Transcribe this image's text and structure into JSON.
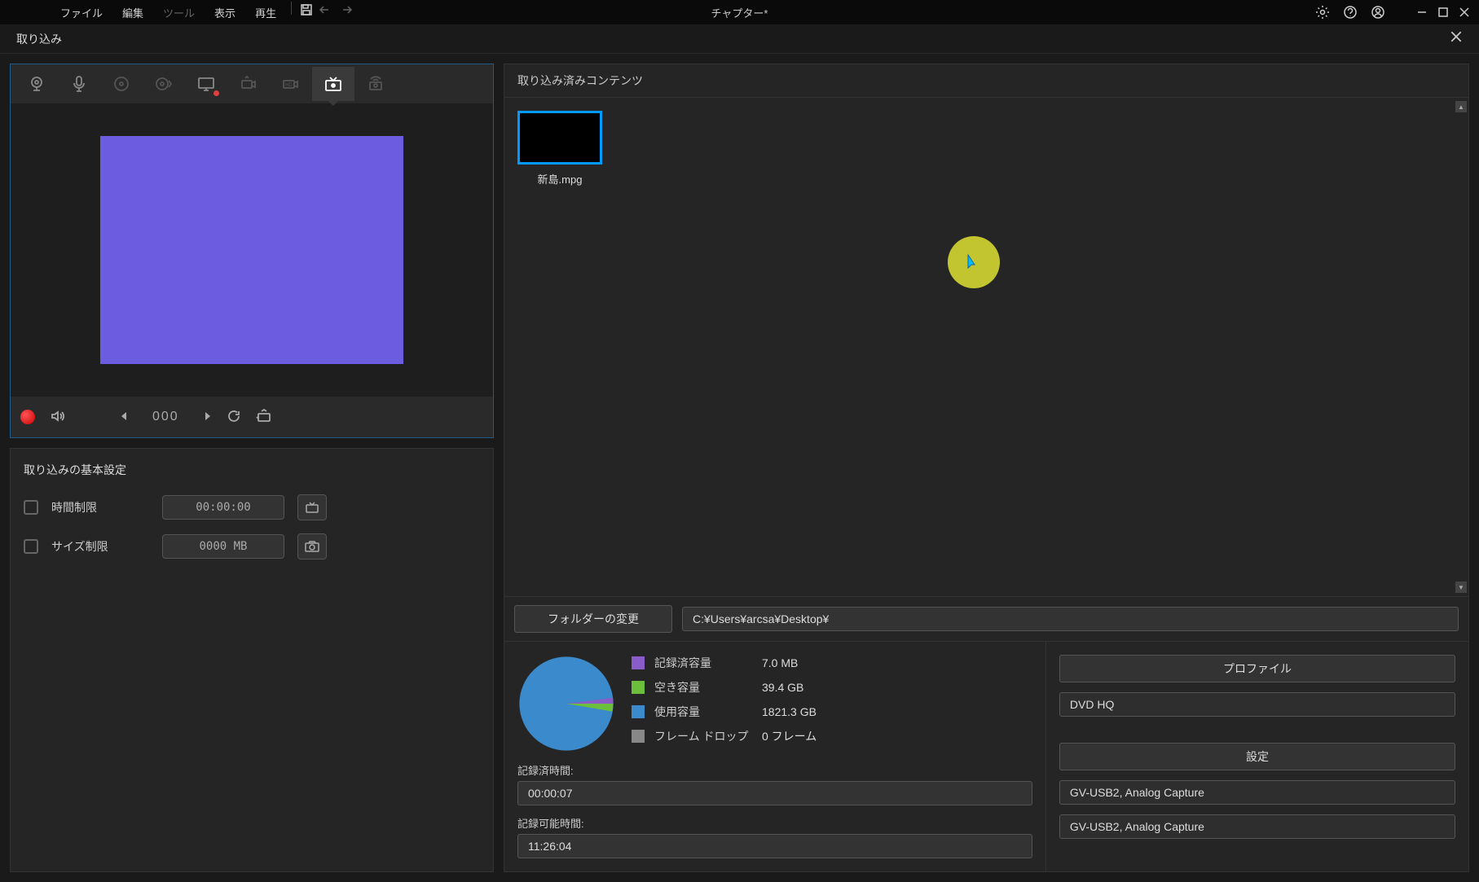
{
  "menu": {
    "file": "ファイル",
    "edit": "編集",
    "tool": "ツール",
    "view": "表示",
    "play": "再生"
  },
  "title": "チャプター*",
  "subHeader": "取り込み",
  "counter": "000",
  "settings": {
    "title": "取り込みの基本設定",
    "timeLimit": "時間制限",
    "timeValue": "00:00:00",
    "sizeLimit": "サイズ制限",
    "sizeValue": "0000  MB"
  },
  "contentHeader": "取り込み済みコンテンツ",
  "thumbnail": {
    "name": "新島.mpg"
  },
  "folder": {
    "changeBtn": "フォルダーの変更",
    "path": "C:¥Users¥arcsa¥Desktop¥"
  },
  "storage": {
    "recordedLabel": "記録済容量",
    "recordedValue": "7.0  MB",
    "freeLabel": "空き容量",
    "freeValue": "39.4  GB",
    "usedLabel": "使用容量",
    "usedValue": "1821.3  GB",
    "frameDropLabel": "フレーム ドロップ",
    "frameDropValue": "0 フレーム",
    "recordedTimeLabel": "記録済時間:",
    "recordedTimeValue": "00:00:07",
    "availableTimeLabel": "記録可能時間:",
    "availableTimeValue": "11:26:04"
  },
  "profile": {
    "profileBtn": "プロファイル",
    "profileValue": "DVD HQ",
    "settingsBtn": "設定",
    "device1": "GV-USB2, Analog Capture",
    "device2": "GV-USB2, Analog Capture"
  },
  "chart_data": {
    "type": "pie",
    "title": "",
    "series": [
      {
        "name": "記録済容量",
        "value": 0.007,
        "unit": "GB",
        "color": "#8a5cc9"
      },
      {
        "name": "空き容量",
        "value": 39.4,
        "unit": "GB",
        "color": "#6cbf3a"
      },
      {
        "name": "使用容量",
        "value": 1821.3,
        "unit": "GB",
        "color": "#3a8acc"
      }
    ]
  }
}
